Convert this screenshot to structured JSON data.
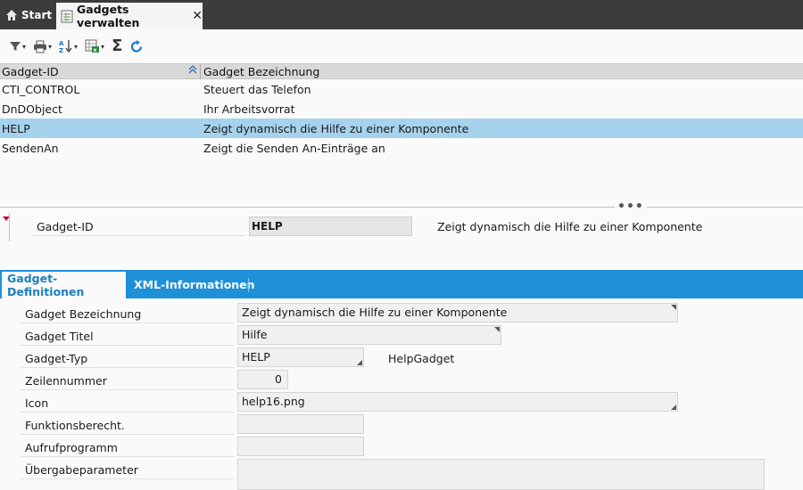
{
  "tabs": {
    "start_label": "Start",
    "active_label": "Gadgets verwalten",
    "close_glyph": "✕"
  },
  "toolbar": {
    "icons": [
      "filter-icon",
      "print-icon",
      "sort-az-icon",
      "export-excel-icon",
      "sum-icon",
      "refresh-icon"
    ],
    "sigma": "Σ"
  },
  "grid": {
    "columns": [
      "Gadget-ID",
      "Gadget Bezeichnung"
    ],
    "sort_glyph": "≈",
    "rows": [
      {
        "id": "CTI_CONTROL",
        "desc": "Steuert das Telefon"
      },
      {
        "id": "DnDObject",
        "desc": "Ihr Arbeitsvorrat"
      },
      {
        "id": "HELP",
        "desc": "Zeigt dynamisch die Hilfe zu einer Komponente"
      },
      {
        "id": "SendenAn",
        "desc": "Zeigt die Senden An-Einträge an"
      }
    ],
    "selected_index": 2
  },
  "splitter": {
    "dots": "•••"
  },
  "key": {
    "label": "Gadget-ID",
    "value": "HELP",
    "description": "Zeigt dynamisch die Hilfe zu einer Komponente"
  },
  "form_tabs": {
    "active": "Gadget-Definitionen",
    "inactive": "XML-Informationen"
  },
  "form": {
    "bezeichnung_label": "Gadget Bezeichnung",
    "bezeichnung_value": "Zeigt dynamisch die Hilfe zu einer Komponente",
    "titel_label": "Gadget Titel",
    "titel_value": "Hilfe",
    "typ_label": "Gadget-Typ",
    "typ_value": "HELP",
    "typ_class": "HelpGadget",
    "zeilennummer_label": "Zeilennummer",
    "zeilennummer_value": "0",
    "icon_label": "Icon",
    "icon_value": "help16.png",
    "funktionsberecht_label": "Funktionsberecht.",
    "funktionsberecht_value": "",
    "aufrufprogramm_label": "Aufrufprogramm",
    "aufrufprogramm_value": "",
    "uebergabeparameter_label": "Übergabeparameter",
    "uebergabeparameter_value": ""
  },
  "colors": {
    "tabbar_bg": "#3c3c3c",
    "selected_row": "#a6d2ee",
    "form_tab_strip": "#1e90d8",
    "active_tab_text": "#1b7fc0",
    "key_marker": "#c01030"
  }
}
